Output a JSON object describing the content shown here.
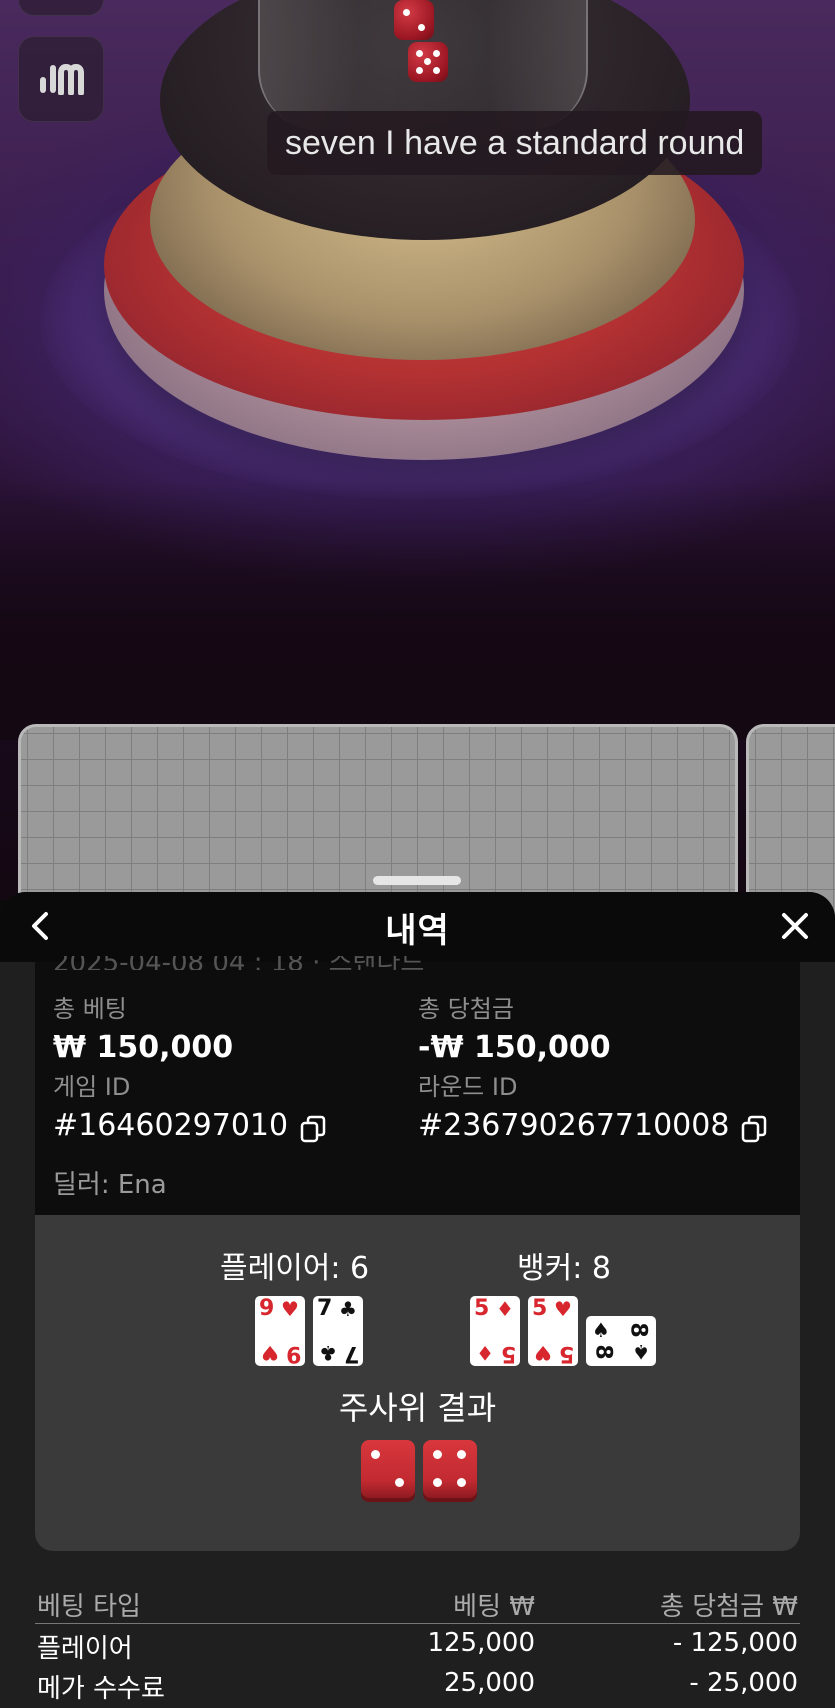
{
  "subtitle": "seven I have a standard round",
  "history": {
    "title": "내역",
    "partial_header_text": "2025-04-08 04 : 18  · 스탠다드",
    "total_bet_label": "총 베팅",
    "total_bet_value": "₩ 150,000",
    "total_win_label": "총 당첨금",
    "total_win_value": "-₩ 150,000",
    "game_id_label": "게임 ID",
    "game_id_value": "#16460297010",
    "round_id_label": "라운드 ID",
    "round_id_value": "#236790267710008",
    "dealer": "딜러: Ena",
    "player_label": "플레이어: 6",
    "banker_label": "뱅커: 8",
    "player_cards": [
      {
        "rank": "9",
        "suit": "♥",
        "color": "red"
      },
      {
        "rank": "7",
        "suit": "♣",
        "color": "black"
      }
    ],
    "banker_cards": [
      {
        "rank": "5",
        "suit": "♦",
        "color": "red"
      },
      {
        "rank": "5",
        "suit": "♥",
        "color": "red"
      },
      {
        "rank": "8",
        "suit": "♠",
        "color": "black",
        "rotated": true
      }
    ],
    "dice_title": "주사위 결과",
    "dice": [
      2,
      4
    ],
    "bets_table": {
      "headers": [
        "베팅 타입",
        "베팅 ₩",
        "총 당첨금 ₩"
      ],
      "rows": [
        [
          "플레이어",
          "125,000",
          "- 125,000"
        ],
        [
          "메가 수수료",
          "25,000",
          "- 25,000"
        ]
      ]
    }
  },
  "icons": {
    "back": "chevron-left-icon",
    "close": "close-icon",
    "stats": "statistics-icon",
    "copy": "copy-icon"
  },
  "colors": {
    "sheet_bg": "#1f1f1f",
    "summary_bg": "#0d0d0d",
    "result_bg": "#3a3a3a",
    "die_red": "#c22a31",
    "card_red": "#d7262d"
  }
}
